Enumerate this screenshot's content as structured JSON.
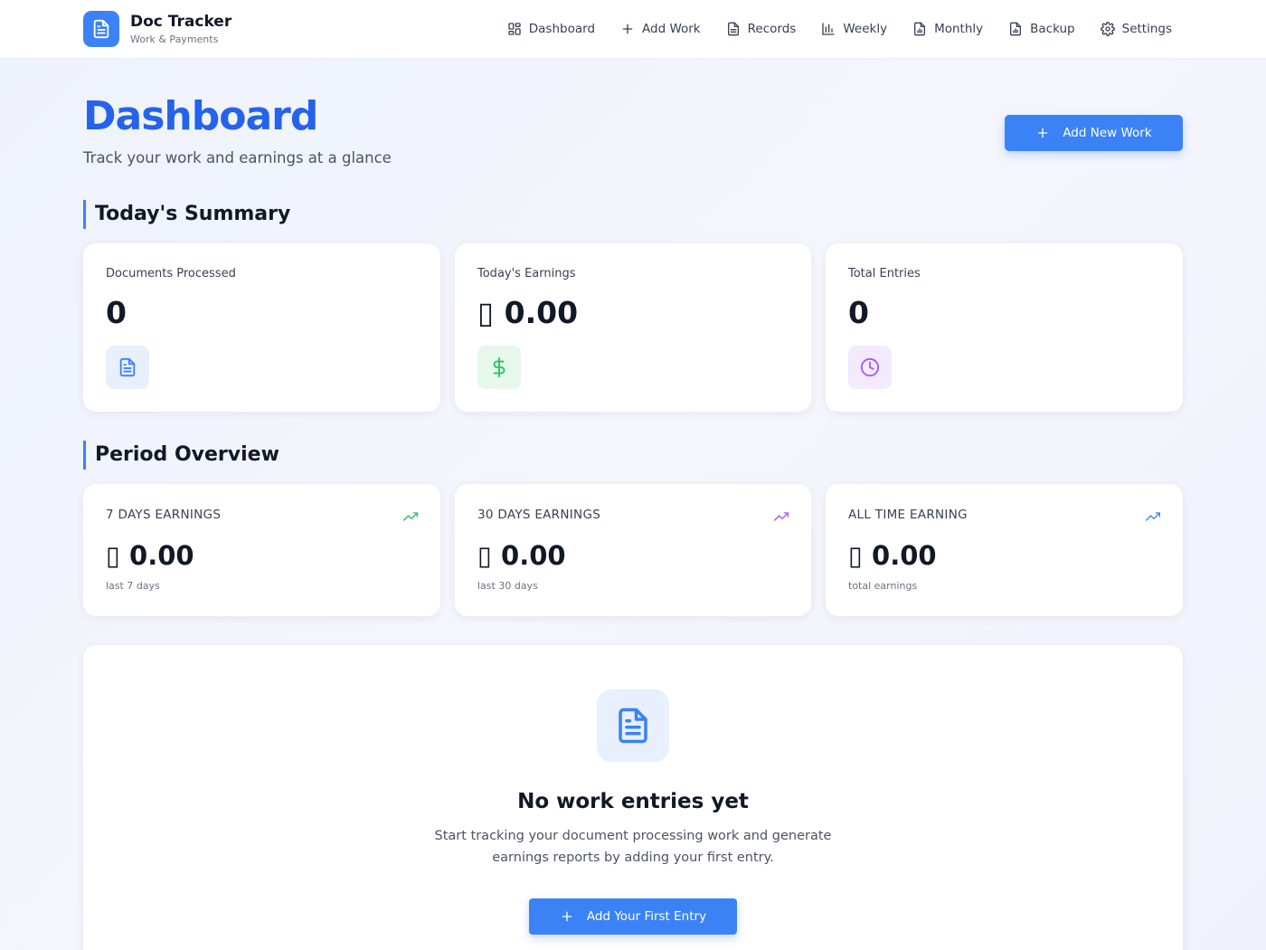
{
  "colors": {
    "accent": "#3b82f6",
    "title": "#2563eb",
    "green": "#22c55e",
    "purple": "#a855f7"
  },
  "brand": {
    "title": "Doc Tracker",
    "subtitle": "Work & Payments",
    "icon": "document-icon"
  },
  "nav": [
    {
      "label": "Dashboard",
      "icon": "grid-icon"
    },
    {
      "label": "Add Work",
      "icon": "plus-icon"
    },
    {
      "label": "Records",
      "icon": "document-icon"
    },
    {
      "label": "Weekly",
      "icon": "bar-chart-icon"
    },
    {
      "label": "Monthly",
      "icon": "file-chart-icon"
    },
    {
      "label": "Backup",
      "icon": "file-chart-icon"
    },
    {
      "label": "Settings",
      "icon": "gear-icon"
    }
  ],
  "page": {
    "title": "Dashboard",
    "subtitle": "Track your work and earnings at a glance",
    "add_button": "Add New Work"
  },
  "today": {
    "title": "Today's Summary",
    "cards": [
      {
        "label": "Documents Processed",
        "value": "0",
        "icon": "document-icon"
      },
      {
        "label": "Today's Earnings",
        "value": "▯ 0.00",
        "icon": "dollar-icon"
      },
      {
        "label": "Total Entries",
        "value": "0",
        "icon": "clock-icon"
      }
    ]
  },
  "period": {
    "title": "Period Overview",
    "cards": [
      {
        "label": "7 Days Earnings",
        "value": "▯ 0.00",
        "note": "last 7 days",
        "icon": "trend-up-icon"
      },
      {
        "label": "30 Days Earnings",
        "value": "▯ 0.00",
        "note": "last 30 days",
        "icon": "trend-up-icon"
      },
      {
        "label": "All Time Earning",
        "value": "▯ 0.00",
        "note": "total earnings",
        "icon": "trend-up-icon"
      }
    ]
  },
  "empty": {
    "title": "No work entries yet",
    "text": "Start tracking your document processing work and generate earnings reports by adding your first entry.",
    "button": "Add Your First Entry",
    "icon": "document-icon"
  }
}
